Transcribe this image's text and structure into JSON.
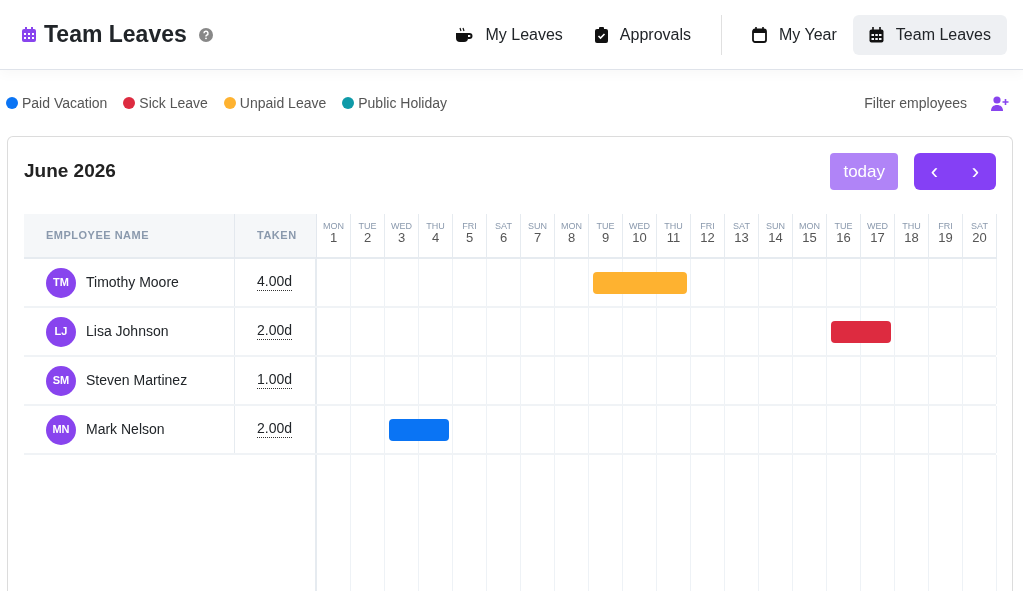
{
  "page": {
    "title": "Team Leaves"
  },
  "nav_groups": [
    [
      {
        "label": "My Leaves",
        "kind": "cup",
        "selected": false
      },
      {
        "label": "Approvals",
        "kind": "clipboard",
        "selected": false
      }
    ],
    [
      {
        "label": "My Year",
        "kind": "calendar",
        "selected": false
      },
      {
        "label": "Team Leaves",
        "kind": "calendar-grid",
        "selected": true
      }
    ]
  ],
  "legend": [
    {
      "kind": "paid",
      "label": "Paid Vacation",
      "color": "#0a74f4"
    },
    {
      "kind": "sick",
      "label": "Sick Leave",
      "color": "#dd2b40"
    },
    {
      "kind": "unpaid",
      "label": "Unpaid Leave",
      "color": "#feb230"
    },
    {
      "kind": "holiday",
      "label": "Public Holiday",
      "color": "#0f9aa8"
    }
  ],
  "filter": {
    "label": "Filter employees"
  },
  "calendar": {
    "month": "June 2026",
    "today_button": "today",
    "prev_button": "‹",
    "next_button": "›",
    "columns": [
      "EMPLOYEE NAME",
      "TAKEN"
    ],
    "days": [
      {
        "weekday": "MON",
        "day": "1"
      },
      {
        "weekday": "TUE",
        "day": "2"
      },
      {
        "weekday": "WED",
        "day": "3"
      },
      {
        "weekday": "THU",
        "day": "4"
      },
      {
        "weekday": "FRI",
        "day": "5"
      },
      {
        "weekday": "SAT",
        "day": "6"
      },
      {
        "weekday": "SUN",
        "day": "7"
      },
      {
        "weekday": "MON",
        "day": "8"
      },
      {
        "weekday": "TUE",
        "day": "9"
      },
      {
        "weekday": "WED",
        "day": "10"
      },
      {
        "weekday": "THU",
        "day": "11"
      },
      {
        "weekday": "FRI",
        "day": "12"
      },
      {
        "weekday": "SAT",
        "day": "13"
      },
      {
        "weekday": "SUN",
        "day": "14"
      },
      {
        "weekday": "MON",
        "day": "15"
      },
      {
        "weekday": "TUE",
        "day": "16"
      },
      {
        "weekday": "WED",
        "day": "17"
      },
      {
        "weekday": "THU",
        "day": "18"
      },
      {
        "weekday": "FRI",
        "day": "19"
      },
      {
        "weekday": "SAT",
        "day": "20"
      }
    ],
    "employees": [
      {
        "initials": "TM",
        "name": "Timothy Moore",
        "taken": "4.00d",
        "timeline": [
          {
            "kind": "none"
          },
          {
            "kind": "none"
          },
          {
            "kind": "none"
          },
          {
            "kind": "none"
          },
          {
            "kind": "none"
          },
          {
            "kind": "none"
          },
          {
            "kind": "none"
          },
          {
            "kind": "none"
          },
          {
            "kind": "unpaid"
          },
          {
            "kind": "unpaid"
          },
          {
            "kind": "unpaid"
          },
          {
            "kind": "none"
          },
          {
            "kind": "none"
          },
          {
            "kind": "none"
          },
          {
            "kind": "none"
          },
          {
            "kind": "none"
          },
          {
            "kind": "none"
          },
          {
            "kind": "none"
          },
          {
            "kind": "none"
          },
          {
            "kind": "none"
          }
        ]
      },
      {
        "initials": "LJ",
        "name": "Lisa Johnson",
        "taken": "2.00d",
        "timeline": [
          {
            "kind": "none"
          },
          {
            "kind": "none"
          },
          {
            "kind": "none"
          },
          {
            "kind": "none"
          },
          {
            "kind": "none"
          },
          {
            "kind": "none"
          },
          {
            "kind": "none"
          },
          {
            "kind": "none"
          },
          {
            "kind": "none"
          },
          {
            "kind": "none"
          },
          {
            "kind": "none"
          },
          {
            "kind": "none"
          },
          {
            "kind": "none"
          },
          {
            "kind": "none"
          },
          {
            "kind": "none"
          },
          {
            "kind": "sick"
          },
          {
            "kind": "sick"
          },
          {
            "kind": "none"
          },
          {
            "kind": "none"
          },
          {
            "kind": "none"
          }
        ]
      },
      {
        "initials": "SM",
        "name": "Steven Martinez",
        "taken": "1.00d",
        "timeline": [
          {
            "kind": "none"
          },
          {
            "kind": "none"
          },
          {
            "kind": "none"
          },
          {
            "kind": "none"
          },
          {
            "kind": "none"
          },
          {
            "kind": "none"
          },
          {
            "kind": "none"
          },
          {
            "kind": "none"
          },
          {
            "kind": "none"
          },
          {
            "kind": "none"
          },
          {
            "kind": "none"
          },
          {
            "kind": "none"
          },
          {
            "kind": "none"
          },
          {
            "kind": "none"
          },
          {
            "kind": "none"
          },
          {
            "kind": "none"
          },
          {
            "kind": "none"
          },
          {
            "kind": "none"
          },
          {
            "kind": "none"
          },
          {
            "kind": "none"
          }
        ]
      },
      {
        "initials": "MN",
        "name": "Mark Nelson",
        "taken": "2.00d",
        "timeline": [
          {
            "kind": "none"
          },
          {
            "kind": "none"
          },
          {
            "kind": "paid"
          },
          {
            "kind": "paid"
          },
          {
            "kind": "none"
          },
          {
            "kind": "none"
          },
          {
            "kind": "none"
          },
          {
            "kind": "none"
          },
          {
            "kind": "none"
          },
          {
            "kind": "none"
          },
          {
            "kind": "none"
          },
          {
            "kind": "none"
          },
          {
            "kind": "none"
          },
          {
            "kind": "none"
          },
          {
            "kind": "none"
          },
          {
            "kind": "none"
          },
          {
            "kind": "none"
          },
          {
            "kind": "none"
          },
          {
            "kind": "none"
          },
          {
            "kind": "none"
          }
        ]
      }
    ]
  }
}
